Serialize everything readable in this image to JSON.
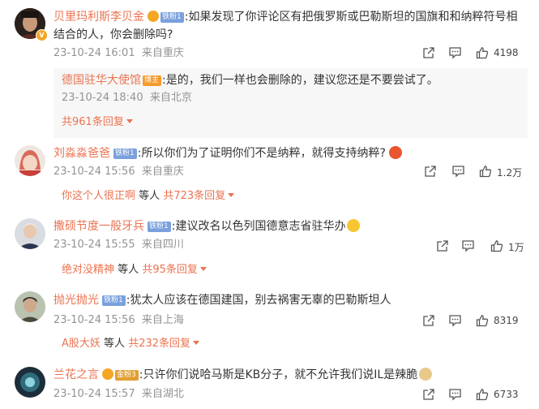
{
  "comments": [
    {
      "name": "贝里玛利斯李贝金",
      "fan_badge": "铁粉1",
      "text": ":如果发现了你评论区有把俄罗斯或巴勒斯坦的国旗和和纳粹符号相结合的人，你会删除吗?",
      "time": "23-10-24 16:01",
      "location": "来自重庆",
      "likes": "4198",
      "reply": {
        "name": "德国驻华大使馆",
        "badge": "博主",
        "text": ":是的，我们一样也会删除的，建议您还是不要尝试了。",
        "time": "23-10-24 18:40",
        "location": "来自北京",
        "replies_label": "共961条回复"
      }
    },
    {
      "name": "刘淼淼爸爸",
      "fan_badge": "铁粉1",
      "text": ":所以你们为了证明你们不是纳粹，就得支持纳粹?",
      "time": "23-10-24 15:56",
      "location": "来自重庆",
      "likes": "1.2万",
      "replier": "你这个人很正啊",
      "replier_suffix": "等人",
      "replies_label": "共723条回复"
    },
    {
      "name": "撒硕节度一般牙兵",
      "fan_badge": "铁粉1",
      "text": ":建议改名以色列国德意志省驻华办",
      "time": "23-10-24 15:55",
      "location": "来自四川",
      "likes": "1万",
      "replier": "绝对没精神",
      "replier_suffix": "等人",
      "replies_label": "共95条回复"
    },
    {
      "name": "抛光抛光",
      "fan_badge": "铁粉1",
      "text": ":犹太人应该在德国建国，别去祸害无辜的巴勒斯坦人",
      "time": "23-10-24 15:56",
      "location": "来自上海",
      "likes": "8319",
      "replier": "A股大妖",
      "replier_suffix": "等人",
      "replies_label": "共232条回复"
    },
    {
      "name": "兰花之言",
      "fan_badge": "金粉3",
      "text": ":只许你们说哈马斯是KB分子，就不允许我们说IL是辣脆",
      "time": "23-10-24 15:57",
      "location": "来自湖北",
      "likes": "6733"
    }
  ],
  "colors": {
    "name": "#eb7350",
    "meta": "#939393",
    "reply_bg": "#f7f7f7"
  },
  "icons": [
    "share-icon",
    "comment-icon",
    "like-icon",
    "verified-icon",
    "reward-icon",
    "dropdown-triangle-icon"
  ]
}
